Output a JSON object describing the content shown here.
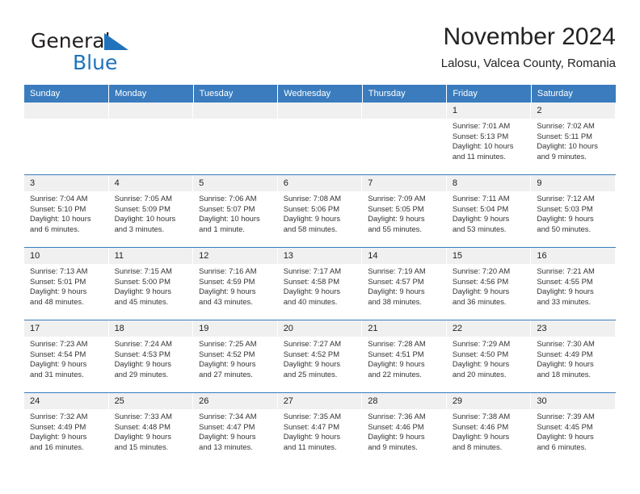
{
  "brand": {
    "word1": "General",
    "word2": "Blue",
    "triangle_color": "#1f72bb",
    "icon": "triangle-logo-icon"
  },
  "header": {
    "title": "November 2024",
    "subtitle": "Lalosu, Valcea County, Romania"
  },
  "colors": {
    "header_blue": "#3a7cbe",
    "daynum_band": "#f0f0f0",
    "text": "#222222"
  },
  "weekday_headers": [
    "Sunday",
    "Monday",
    "Tuesday",
    "Wednesday",
    "Thursday",
    "Friday",
    "Saturday"
  ],
  "weeks": [
    [
      {
        "day": "",
        "lines": []
      },
      {
        "day": "",
        "lines": []
      },
      {
        "day": "",
        "lines": []
      },
      {
        "day": "",
        "lines": []
      },
      {
        "day": "",
        "lines": []
      },
      {
        "day": "1",
        "lines": [
          "Sunrise: 7:01 AM",
          "Sunset: 5:13 PM",
          "Daylight: 10 hours",
          "and 11 minutes."
        ]
      },
      {
        "day": "2",
        "lines": [
          "Sunrise: 7:02 AM",
          "Sunset: 5:11 PM",
          "Daylight: 10 hours",
          "and 9 minutes."
        ]
      }
    ],
    [
      {
        "day": "3",
        "lines": [
          "Sunrise: 7:04 AM",
          "Sunset: 5:10 PM",
          "Daylight: 10 hours",
          "and 6 minutes."
        ]
      },
      {
        "day": "4",
        "lines": [
          "Sunrise: 7:05 AM",
          "Sunset: 5:09 PM",
          "Daylight: 10 hours",
          "and 3 minutes."
        ]
      },
      {
        "day": "5",
        "lines": [
          "Sunrise: 7:06 AM",
          "Sunset: 5:07 PM",
          "Daylight: 10 hours",
          "and 1 minute."
        ]
      },
      {
        "day": "6",
        "lines": [
          "Sunrise: 7:08 AM",
          "Sunset: 5:06 PM",
          "Daylight: 9 hours",
          "and 58 minutes."
        ]
      },
      {
        "day": "7",
        "lines": [
          "Sunrise: 7:09 AM",
          "Sunset: 5:05 PM",
          "Daylight: 9 hours",
          "and 55 minutes."
        ]
      },
      {
        "day": "8",
        "lines": [
          "Sunrise: 7:11 AM",
          "Sunset: 5:04 PM",
          "Daylight: 9 hours",
          "and 53 minutes."
        ]
      },
      {
        "day": "9",
        "lines": [
          "Sunrise: 7:12 AM",
          "Sunset: 5:03 PM",
          "Daylight: 9 hours",
          "and 50 minutes."
        ]
      }
    ],
    [
      {
        "day": "10",
        "lines": [
          "Sunrise: 7:13 AM",
          "Sunset: 5:01 PM",
          "Daylight: 9 hours",
          "and 48 minutes."
        ]
      },
      {
        "day": "11",
        "lines": [
          "Sunrise: 7:15 AM",
          "Sunset: 5:00 PM",
          "Daylight: 9 hours",
          "and 45 minutes."
        ]
      },
      {
        "day": "12",
        "lines": [
          "Sunrise: 7:16 AM",
          "Sunset: 4:59 PM",
          "Daylight: 9 hours",
          "and 43 minutes."
        ]
      },
      {
        "day": "13",
        "lines": [
          "Sunrise: 7:17 AM",
          "Sunset: 4:58 PM",
          "Daylight: 9 hours",
          "and 40 minutes."
        ]
      },
      {
        "day": "14",
        "lines": [
          "Sunrise: 7:19 AM",
          "Sunset: 4:57 PM",
          "Daylight: 9 hours",
          "and 38 minutes."
        ]
      },
      {
        "day": "15",
        "lines": [
          "Sunrise: 7:20 AM",
          "Sunset: 4:56 PM",
          "Daylight: 9 hours",
          "and 36 minutes."
        ]
      },
      {
        "day": "16",
        "lines": [
          "Sunrise: 7:21 AM",
          "Sunset: 4:55 PM",
          "Daylight: 9 hours",
          "and 33 minutes."
        ]
      }
    ],
    [
      {
        "day": "17",
        "lines": [
          "Sunrise: 7:23 AM",
          "Sunset: 4:54 PM",
          "Daylight: 9 hours",
          "and 31 minutes."
        ]
      },
      {
        "day": "18",
        "lines": [
          "Sunrise: 7:24 AM",
          "Sunset: 4:53 PM",
          "Daylight: 9 hours",
          "and 29 minutes."
        ]
      },
      {
        "day": "19",
        "lines": [
          "Sunrise: 7:25 AM",
          "Sunset: 4:52 PM",
          "Daylight: 9 hours",
          "and 27 minutes."
        ]
      },
      {
        "day": "20",
        "lines": [
          "Sunrise: 7:27 AM",
          "Sunset: 4:52 PM",
          "Daylight: 9 hours",
          "and 25 minutes."
        ]
      },
      {
        "day": "21",
        "lines": [
          "Sunrise: 7:28 AM",
          "Sunset: 4:51 PM",
          "Daylight: 9 hours",
          "and 22 minutes."
        ]
      },
      {
        "day": "22",
        "lines": [
          "Sunrise: 7:29 AM",
          "Sunset: 4:50 PM",
          "Daylight: 9 hours",
          "and 20 minutes."
        ]
      },
      {
        "day": "23",
        "lines": [
          "Sunrise: 7:30 AM",
          "Sunset: 4:49 PM",
          "Daylight: 9 hours",
          "and 18 minutes."
        ]
      }
    ],
    [
      {
        "day": "24",
        "lines": [
          "Sunrise: 7:32 AM",
          "Sunset: 4:49 PM",
          "Daylight: 9 hours",
          "and 16 minutes."
        ]
      },
      {
        "day": "25",
        "lines": [
          "Sunrise: 7:33 AM",
          "Sunset: 4:48 PM",
          "Daylight: 9 hours",
          "and 15 minutes."
        ]
      },
      {
        "day": "26",
        "lines": [
          "Sunrise: 7:34 AM",
          "Sunset: 4:47 PM",
          "Daylight: 9 hours",
          "and 13 minutes."
        ]
      },
      {
        "day": "27",
        "lines": [
          "Sunrise: 7:35 AM",
          "Sunset: 4:47 PM",
          "Daylight: 9 hours",
          "and 11 minutes."
        ]
      },
      {
        "day": "28",
        "lines": [
          "Sunrise: 7:36 AM",
          "Sunset: 4:46 PM",
          "Daylight: 9 hours",
          "and 9 minutes."
        ]
      },
      {
        "day": "29",
        "lines": [
          "Sunrise: 7:38 AM",
          "Sunset: 4:46 PM",
          "Daylight: 9 hours",
          "and 8 minutes."
        ]
      },
      {
        "day": "30",
        "lines": [
          "Sunrise: 7:39 AM",
          "Sunset: 4:45 PM",
          "Daylight: 9 hours",
          "and 6 minutes."
        ]
      }
    ]
  ]
}
